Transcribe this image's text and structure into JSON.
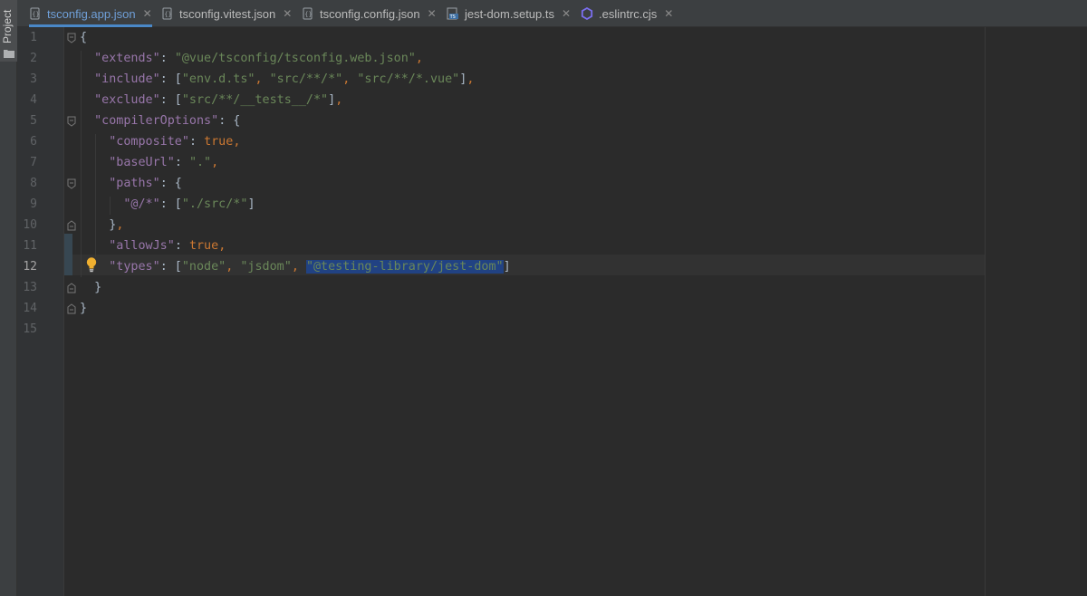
{
  "sidebar": {
    "project_label": "Project"
  },
  "tabs": [
    {
      "label": "tsconfig.app.json",
      "icon": "json-config-icon",
      "active": true
    },
    {
      "label": "tsconfig.vitest.json",
      "icon": "json-config-icon",
      "active": false
    },
    {
      "label": "tsconfig.config.json",
      "icon": "json-config-icon",
      "active": false
    },
    {
      "label": "jest-dom.setup.ts",
      "icon": "typescript-file-icon",
      "active": false
    },
    {
      "label": ".eslintrc.cjs",
      "icon": "eslint-icon",
      "active": false
    }
  ],
  "tab_close_glyph": "✕",
  "editor": {
    "current_line": 12,
    "line_numbers": [
      "1",
      "2",
      "3",
      "4",
      "5",
      "6",
      "7",
      "8",
      "9",
      "10",
      "11",
      "12",
      "13",
      "14",
      "15"
    ],
    "lines": [
      "{",
      "  \"extends\": \"@vue/tsconfig/tsconfig.web.json\",",
      "  \"include\": [\"env.d.ts\", \"src/**/*\", \"src/**/*.vue\"],",
      "  \"exclude\": [\"src/**/__tests__/*\"],",
      "  \"compilerOptions\": {",
      "    \"composite\": true,",
      "    \"baseUrl\": \".\",",
      "    \"paths\": {",
      "      \"@/*\": [\"./src/*\"]",
      "    },",
      "    \"allowJs\": true,",
      "    \"types\": [\"node\", \"jsdom\", \"@testing-library/jest-dom\"]",
      "  }",
      "}",
      ""
    ],
    "selected_text": "\"@testing-library/jest-dom\""
  },
  "colors": {
    "background": "#2b2b2b",
    "key": "#9876aa",
    "string": "#6a8759",
    "keyword": "#cc7832",
    "selection": "#214283",
    "active_tab": "#6f9fd8"
  }
}
